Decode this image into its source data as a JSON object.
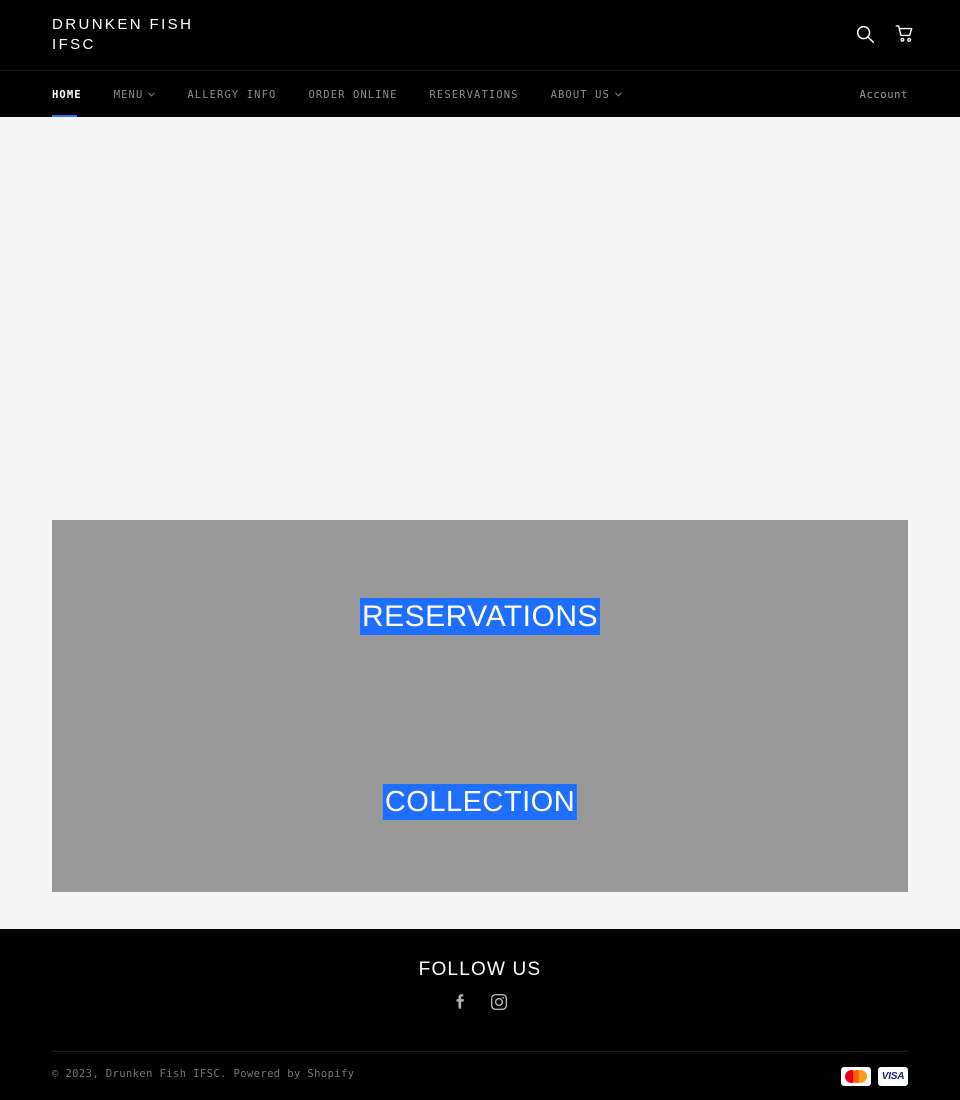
{
  "header": {
    "logo_text": "DRUNKEN FISH\nIFSC",
    "search_icon": "search-icon",
    "cart_icon": "cart-icon"
  },
  "nav": {
    "items": [
      {
        "label": "Home",
        "active": true,
        "has_caret": false
      },
      {
        "label": "Menu",
        "active": false,
        "has_caret": true
      },
      {
        "label": "Allergy Info",
        "active": false,
        "has_caret": false
      },
      {
        "label": "Order Online",
        "active": false,
        "has_caret": false
      },
      {
        "label": "Reservations",
        "active": false,
        "has_caret": false
      },
      {
        "label": "About Us",
        "active": false,
        "has_caret": true
      }
    ],
    "account_label": "Account",
    "active_indicator_color": "#2176ff"
  },
  "main": {
    "media_block_color": "#999999",
    "highlight_color": "#1f6fff",
    "links": [
      {
        "label": "RESERVATIONS"
      },
      {
        "label": "COLLECTION"
      }
    ]
  },
  "footer": {
    "follow_title": "FOLLOW US",
    "social": [
      {
        "name": "facebook-icon",
        "label": "Facebook"
      },
      {
        "name": "instagram-icon",
        "label": "Instagram"
      }
    ],
    "copyright_prefix": "© 2023, Drunken Fish IFSC. Powered by ",
    "shopify_label": "Shopify",
    "payments": [
      {
        "name": "mastercard-icon",
        "label": "Mastercard"
      },
      {
        "name": "visa-icon",
        "label": "VISA"
      }
    ]
  }
}
